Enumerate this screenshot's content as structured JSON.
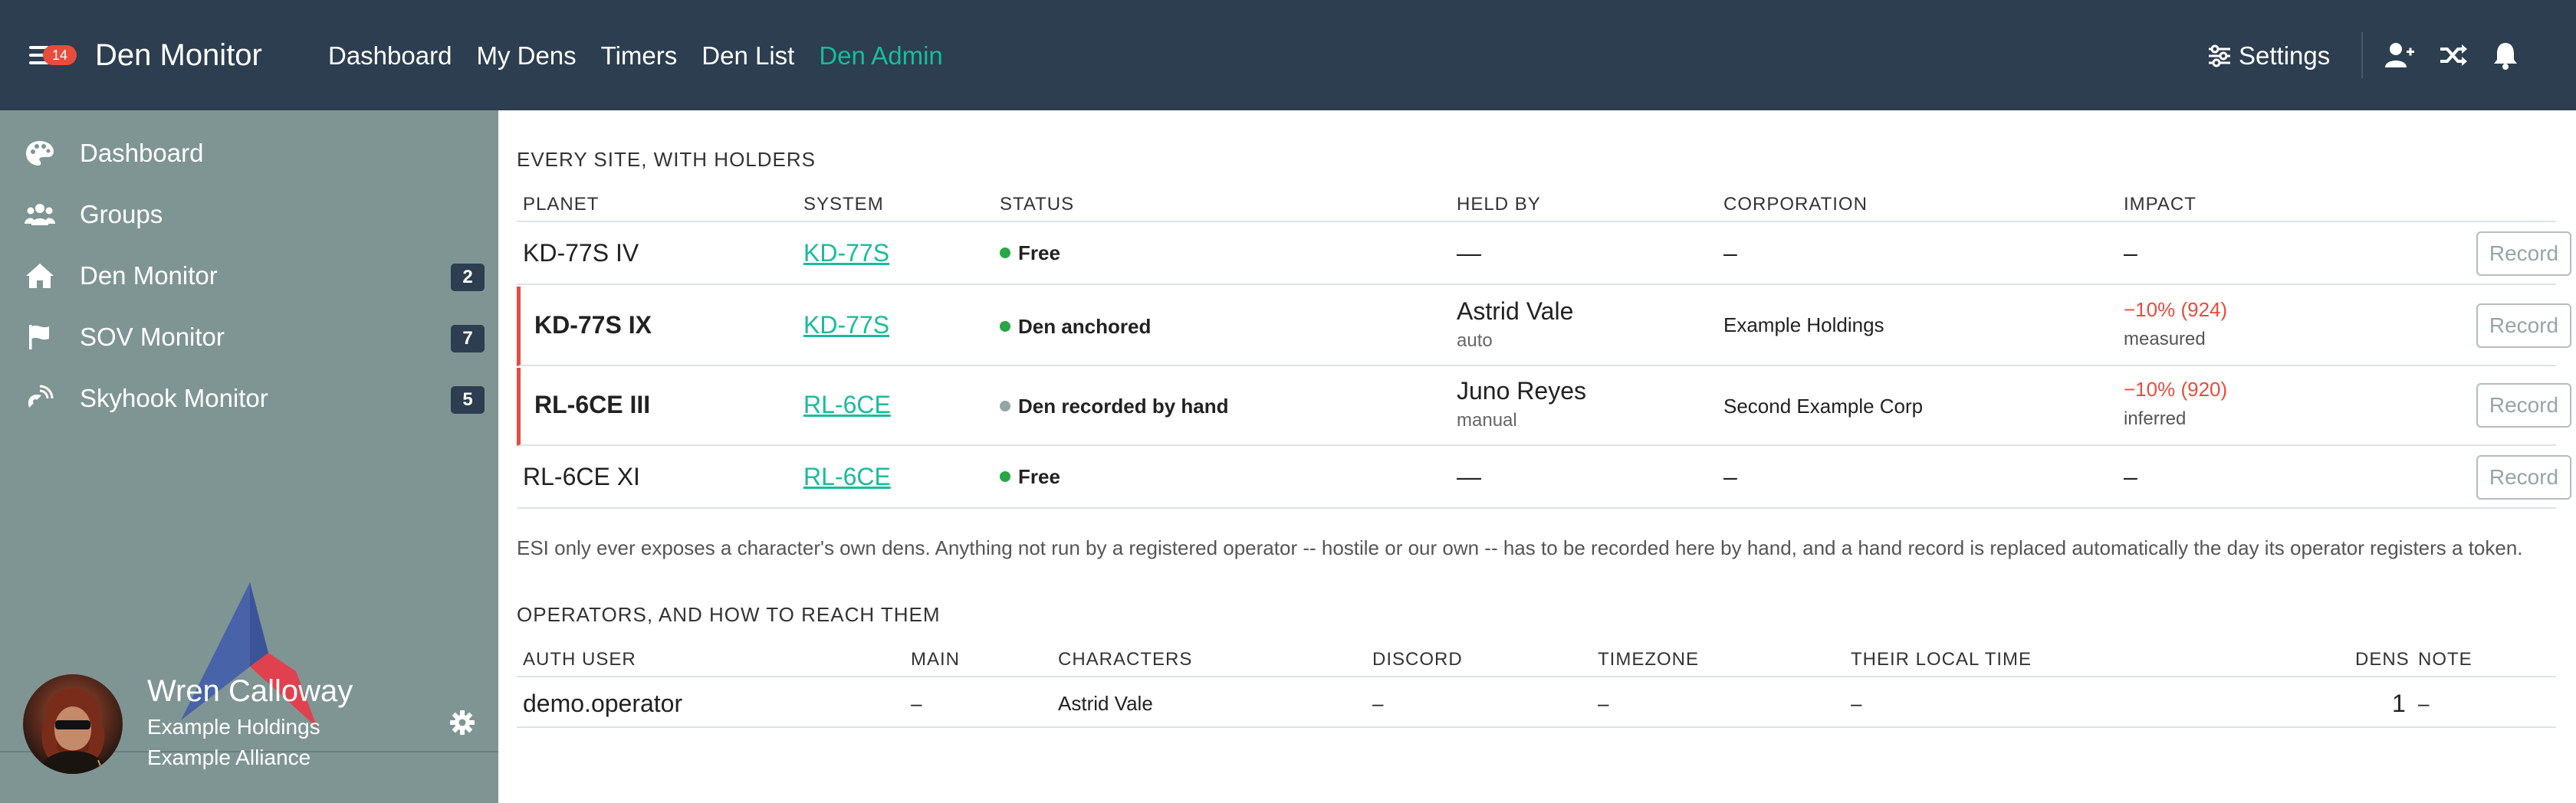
{
  "navbar": {
    "menu_badge": "14",
    "brand": "Den Monitor",
    "links": [
      "Dashboard",
      "My Dens",
      "Timers",
      "Den List",
      "Den Admin"
    ],
    "active_link": "Den Admin",
    "settings_label": "Settings",
    "icons": [
      "add-user-icon",
      "shuffle-icon",
      "bell-icon"
    ],
    "colors": {
      "bar": "#2c3e50",
      "accent": "#18bc9c",
      "badge": "#e74c3c"
    }
  },
  "sidebar": {
    "items": [
      {
        "label": "Dashboard",
        "icon": "palette-icon",
        "count": ""
      },
      {
        "label": "Groups",
        "icon": "users-icon",
        "count": ""
      },
      {
        "label": "Den Monitor",
        "icon": "house-icon",
        "count": "2"
      },
      {
        "label": "SOV Monitor",
        "icon": "flag-icon",
        "count": "7"
      },
      {
        "label": "Skyhook Monitor",
        "icon": "satellite-icon",
        "count": "5"
      }
    ],
    "user": {
      "name": "Wren Calloway",
      "corporation": "Example Holdings",
      "alliance": "Example Alliance"
    }
  },
  "sites": {
    "title": "EVERY SITE, WITH HOLDERS",
    "headers": [
      "PLANET",
      "SYSTEM",
      "STATUS",
      "HELD BY",
      "CORPORATION",
      "IMPACT"
    ],
    "record_label": "Record",
    "rows": [
      {
        "planet": "KD-77S IV",
        "system": "KD-77S",
        "status": "Free",
        "status_color": "#28a745",
        "held_by": "—",
        "held_sub": "",
        "corporation": "–",
        "impact": "–",
        "impact_sub": ""
      },
      {
        "planet": "KD-77S IX",
        "system": "KD-77S",
        "status": "Den anchored",
        "status_color": "#28a745",
        "held_by": "Astrid Vale",
        "held_sub": "auto",
        "corporation": "Example Holdings",
        "impact": "−10% (924)",
        "impact_sub": "measured"
      },
      {
        "planet": "RL-6CE III",
        "system": "RL-6CE",
        "status": "Den recorded by hand",
        "status_color": "#95a5a6",
        "held_by": "Juno Reyes",
        "held_sub": "manual",
        "corporation": "Second Example Corp",
        "impact": "−10% (920)",
        "impact_sub": "inferred"
      },
      {
        "planet": "RL-6CE XI",
        "system": "RL-6CE",
        "status": "Free",
        "status_color": "#28a745",
        "held_by": "—",
        "held_sub": "",
        "corporation": "–",
        "impact": "–",
        "impact_sub": ""
      }
    ],
    "note": "ESI only ever exposes a character's own dens. Anything not run by a registered operator -- hostile or our own -- has to be recorded here by hand, and a hand record is replaced automatically the day its operator registers a token."
  },
  "operators": {
    "title": "OPERATORS, AND HOW TO REACH THEM",
    "headers": [
      "AUTH USER",
      "MAIN",
      "CHARACTERS",
      "DISCORD",
      "TIMEZONE",
      "THEIR LOCAL TIME",
      "DENS",
      "NOTE"
    ],
    "rows": [
      {
        "auth_user": "demo.operator",
        "main": "–",
        "characters": "Astrid Vale",
        "discord": "–",
        "timezone": "–",
        "local_time": "–",
        "dens": "1",
        "note": "–"
      }
    ]
  }
}
